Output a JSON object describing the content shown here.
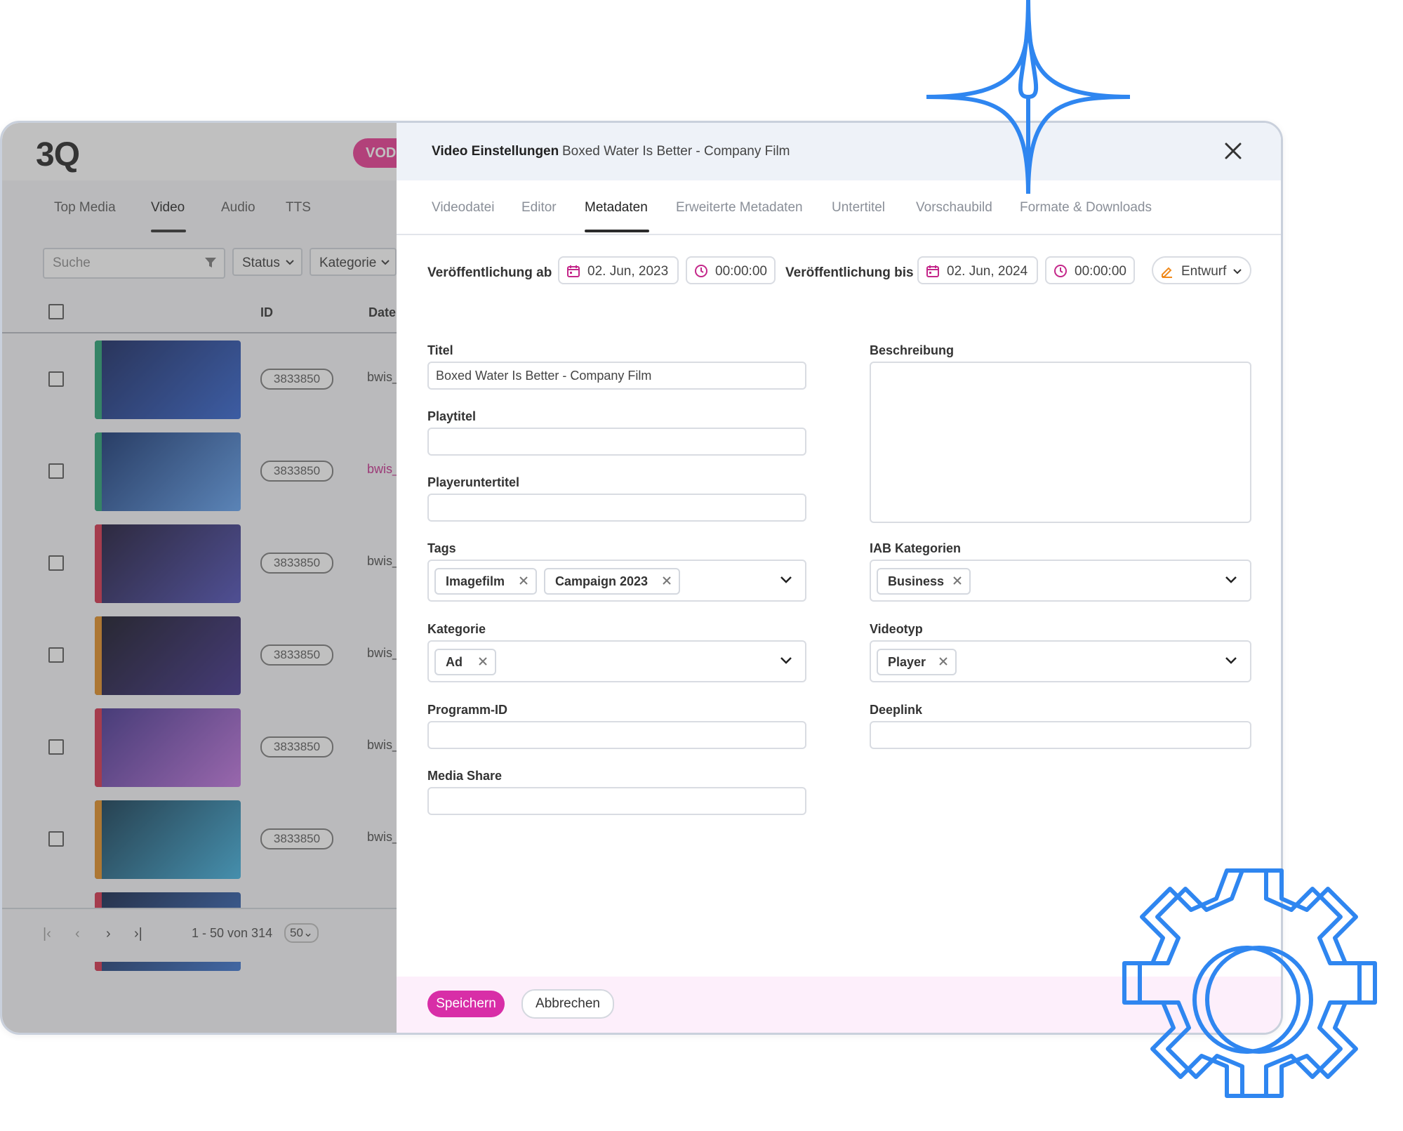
{
  "app": {
    "logo": "3Q",
    "mode_badge": "VOD"
  },
  "list": {
    "tabs": [
      "Top Media",
      "Video",
      "Audio",
      "TTS"
    ],
    "active_tab": "Video",
    "search_placeholder": "Suche",
    "filters": [
      "Status",
      "Kategorie"
    ],
    "columns": [
      "ID",
      "Date"
    ],
    "rows": [
      {
        "id": "3833850",
        "file": "bwis_",
        "bar_color": "#1f9e6e",
        "highlight": false
      },
      {
        "id": "3833850",
        "file": "bwis_",
        "bar_color": "#1f9e6e",
        "highlight": true
      },
      {
        "id": "3833850",
        "file": "bwis_",
        "bar_color": "#d42b46",
        "highlight": false
      },
      {
        "id": "3833850",
        "file": "bwis_",
        "bar_color": "#e08a1c",
        "highlight": false
      },
      {
        "id": "3833850",
        "file": "bwis_",
        "bar_color": "#d42b46",
        "highlight": false
      },
      {
        "id": "3833850",
        "file": "bwis_",
        "bar_color": "#e08a1c",
        "highlight": false
      },
      {
        "id": "3833850",
        "file": "bwis_",
        "bar_color": "#d42b46",
        "highlight": false
      }
    ],
    "pagination": {
      "range": "1 - 50 von 314",
      "page_size": "50"
    }
  },
  "settings": {
    "title": "Video Einstellungen",
    "subtitle": "Boxed Water Is Better - Company Film",
    "tabs": [
      "Videodatei",
      "Editor",
      "Metadaten",
      "Erweiterte Metadaten",
      "Untertitel",
      "Vorschaubild",
      "Formate & Downloads"
    ],
    "active_tab": "Metadaten",
    "publish_from_label": "Veröffentlichung ab",
    "publish_from_date": "02. Jun, 2023",
    "publish_from_time": "00:00:00",
    "publish_to_label": "Veröffentlichung bis",
    "publish_to_date": "02. Jun, 2024",
    "publish_to_time": "00:00:00",
    "status": "Entwurf",
    "fields": {
      "titel_label": "Titel",
      "titel_value": "Boxed Water Is Better - Company Film",
      "playtitel_label": "Playtitel",
      "playeruntertitel_label": "Playeruntertitel",
      "beschreibung_label": "Beschreibung",
      "tags_label": "Tags",
      "tags": [
        "Imagefilm",
        "Campaign 2023"
      ],
      "iab_label": "IAB Kategorien",
      "iab": [
        "Business"
      ],
      "kategorie_label": "Kategorie",
      "kategorie": [
        "Ad"
      ],
      "videotyp_label": "Videotyp",
      "videotyp": [
        "Player"
      ],
      "programm_id_label": "Programm-ID",
      "deeplink_label": "Deeplink",
      "media_share_label": "Media Share"
    },
    "save_label": "Speichern",
    "cancel_label": "Abbrechen"
  },
  "colors": {
    "accent": "#d82ea7",
    "badge": "#e9338f",
    "deco_blue": "#2f86f0",
    "icon_magenta": "#c4278a",
    "icon_orange": "#f08a1c"
  }
}
